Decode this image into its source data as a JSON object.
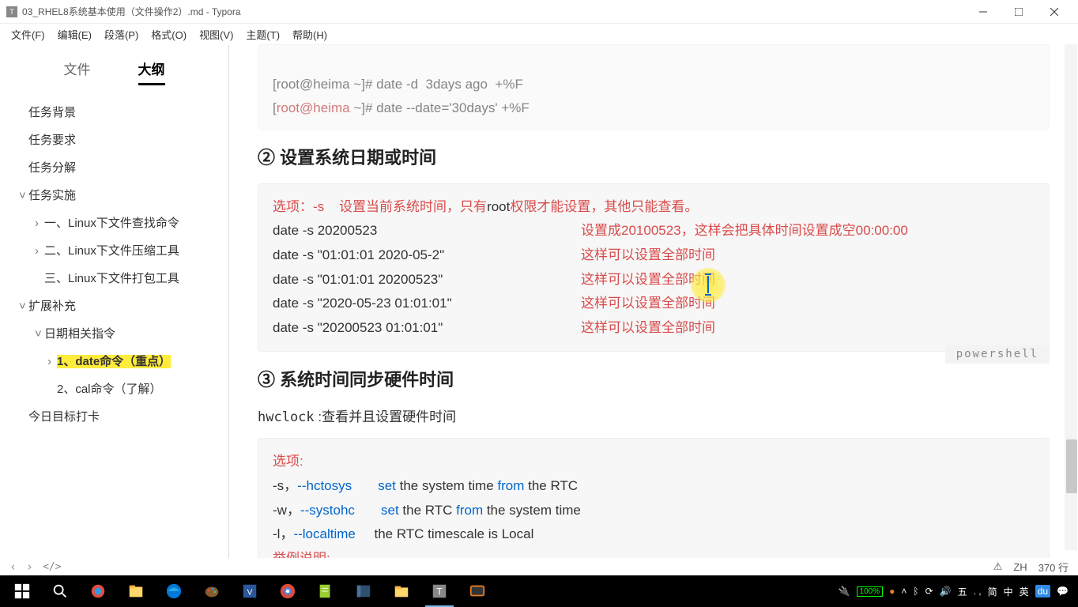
{
  "titlebar": {
    "icon_letter": "T",
    "title": "03_RHEL8系统基本使用（文件操作2）.md - Typora"
  },
  "menubar": {
    "items": [
      "文件(F)",
      "编辑(E)",
      "段落(P)",
      "格式(O)",
      "视图(V)",
      "主题(T)",
      "帮助(H)"
    ]
  },
  "sidebar": {
    "tabs": {
      "file": "文件",
      "outline": "大纲"
    },
    "outline": [
      {
        "level": 1,
        "caret": "",
        "text": "任务背景"
      },
      {
        "level": 1,
        "caret": "",
        "text": "任务要求"
      },
      {
        "level": 1,
        "caret": "",
        "text": "任务分解"
      },
      {
        "level": 1,
        "caret": "˅",
        "text": "任务实施"
      },
      {
        "level": 2,
        "caret": "›",
        "text": "一、Linux下文件查找命令"
      },
      {
        "level": 2,
        "caret": "›",
        "text": "二、Linux下文件压缩工具"
      },
      {
        "level": 2,
        "caret": "",
        "text": "三、Linux下文件打包工具"
      },
      {
        "level": 1,
        "caret": "˅",
        "text": "扩展补充"
      },
      {
        "level": 2,
        "caret": "˅",
        "text": "日期相关指令"
      },
      {
        "level": 3,
        "caret": "›",
        "text": "1、date命令（重点）",
        "hl": true
      },
      {
        "level": 3,
        "caret": "",
        "text": "2、cal命令（了解）"
      },
      {
        "level": 1,
        "caret": "",
        "text": "今日目标打卡"
      }
    ]
  },
  "content": {
    "top_code": {
      "l1_pre": "[root@heima ~]# date -d  3days ago  +%F",
      "l2_prompt": "[",
      "l2_user": "root@heima",
      "l2_tilde": " ~",
      "l2_hash": "]# ",
      "l2_cmd": "date --date='30days' +%F"
    },
    "h2_1": "② 设置系统日期或时间",
    "block1": {
      "opt_pre": "选项：-s    设置当前系统时间，只有",
      "opt_root": "root",
      "opt_post": "权限才能设置，其他只能查看。",
      "rows": [
        {
          "left": "date -s 20200523",
          "right": "设置成20100523，这样会把具体时间设置成空00:00:00"
        },
        {
          "left": "date -s \"01:01:01 2020-05-2\"",
          "right": "这样可以设置全部时间"
        },
        {
          "left": "date -s \"01:01:01 20200523\"",
          "right": "这样可以设置全部时间"
        },
        {
          "left": "date -s \"2020-05-23 01:01:01\"",
          "right": "这样可以设置全部时间"
        },
        {
          "left": "date -s \"20200523 01:01:01\"",
          "right": "这样可以设置全部时间"
        }
      ]
    },
    "lang_tag": "powershell",
    "h2_2": "③ 系统时间同步硬件时间",
    "para1_cmd": "hwclock",
    "para1_txt": " :查看并且设置硬件时间",
    "block2": {
      "opt": "选项:",
      "rows": [
        {
          "a": "-s，",
          "b": "--hctosys",
          "c": "       set",
          "mid": " the system time ",
          "d": "from",
          "e": " the RTC"
        },
        {
          "a": "-w，",
          "b": "--systohc",
          "c": "       set",
          "mid": " the RTC ",
          "d": "from",
          "e": " the system time"
        },
        {
          "a": "-l，",
          "b": "--localtime",
          "c": "     the",
          "mid": " RTC timescale is Local",
          "d": "",
          "e": ""
        }
      ],
      "example": "举例说明:"
    }
  },
  "statusbar": {
    "back": "‹",
    "fwd": "›",
    "tag": "</>",
    "warn": "⚠",
    "lang": "ZH",
    "lines": "370 行"
  },
  "taskbar": {
    "battery": "100%",
    "ime1": "五",
    "ime2": ". ,",
    "ime3": "简",
    "ime4": "中",
    "ime5": "英"
  }
}
